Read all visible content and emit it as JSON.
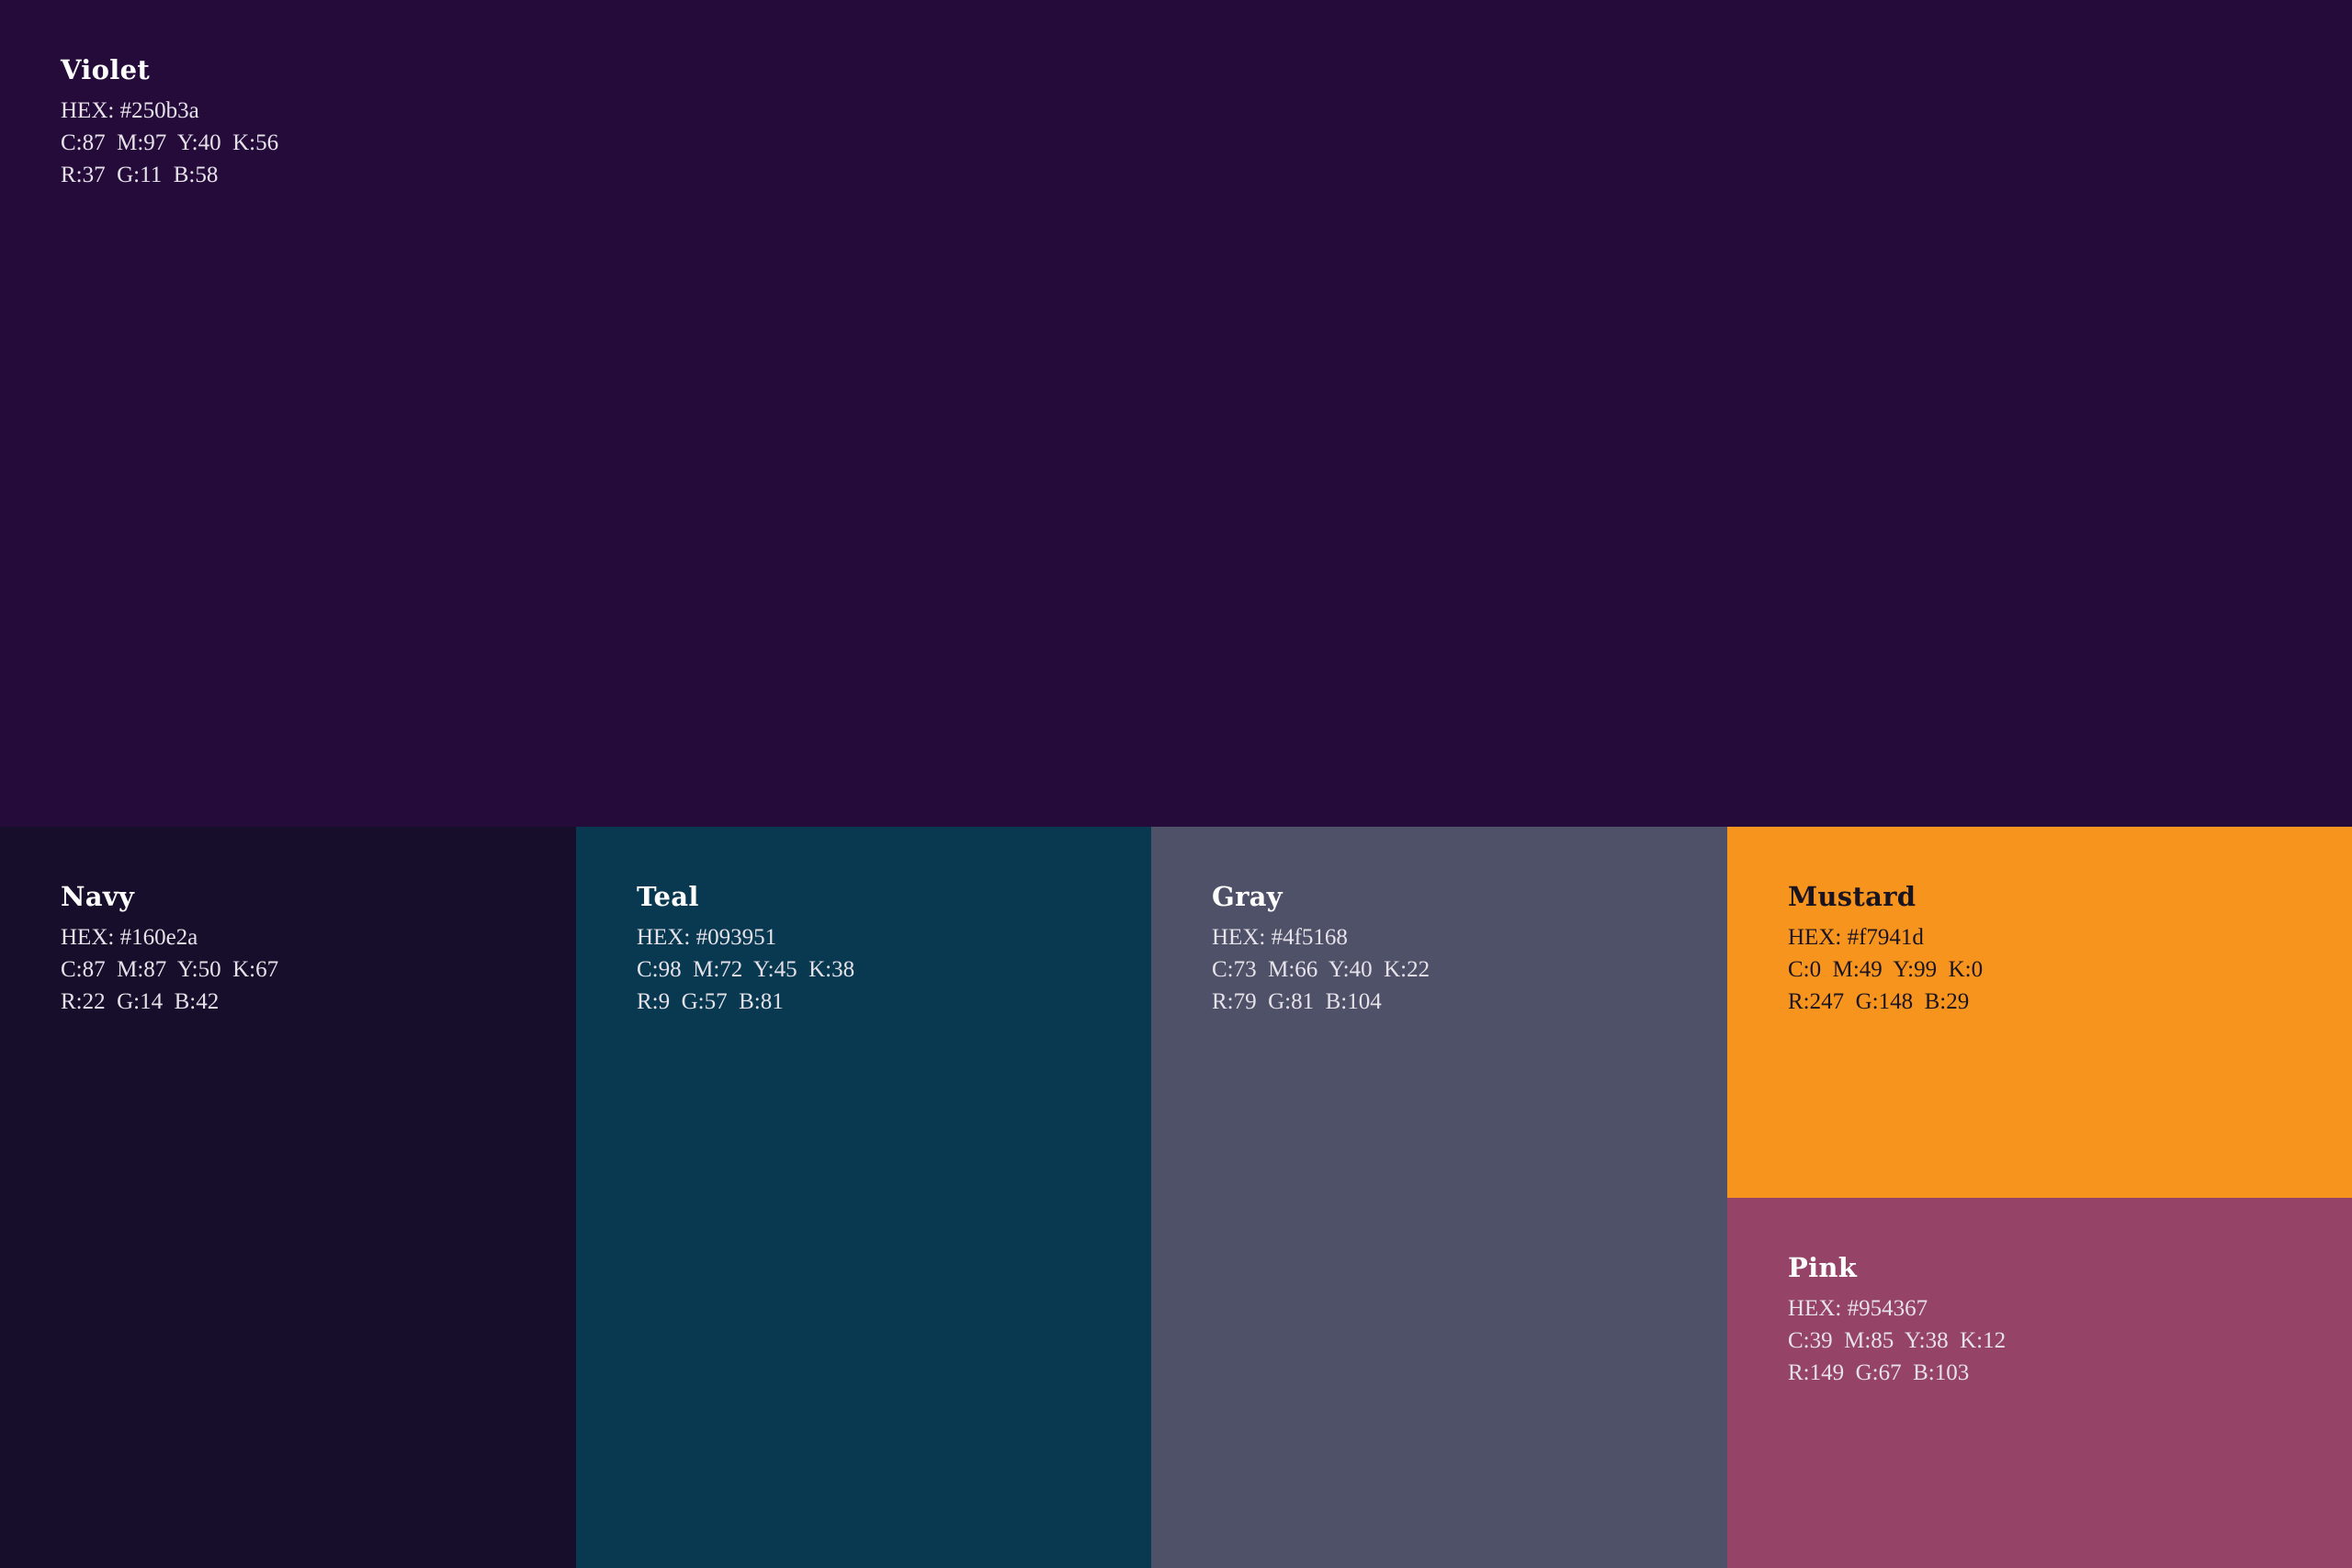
{
  "swatches": {
    "violet": {
      "name": "Violet",
      "hex_line": "HEX: #250b3a",
      "cmyk_line": "C:87  M:97  Y:40  K:56",
      "rgb_line": "R:37  G:11  B:58",
      "color": "#250b3a"
    },
    "navy": {
      "name": "Navy",
      "hex_line": "HEX: #160e2a",
      "cmyk_line": "C:87  M:87  Y:50  K:67",
      "rgb_line": "R:22  G:14  B:42",
      "color": "#160e2a"
    },
    "teal": {
      "name": "Teal",
      "hex_line": "HEX: #093951",
      "cmyk_line": "C:98  M:72  Y:45  K:38",
      "rgb_line": "R:9  G:57  B:81",
      "color": "#093951"
    },
    "gray": {
      "name": "Gray",
      "hex_line": "HEX: #4f5168",
      "cmyk_line": "C:73  M:66  Y:40  K:22",
      "rgb_line": "R:79  G:81  B:104",
      "color": "#4f5168"
    },
    "mustard": {
      "name": "Mustard",
      "hex_line": "HEX: #f7941d",
      "cmyk_line": "C:0  M:49  Y:99  K:0",
      "rgb_line": "R:247  G:148  B:29",
      "color": "#f7941d"
    },
    "pink": {
      "name": "Pink",
      "hex_line": "HEX: #954367",
      "cmyk_line": "C:39  M:85  Y:38  K:12",
      "rgb_line": "R:149  G:67  B:103",
      "color": "#954367"
    }
  }
}
